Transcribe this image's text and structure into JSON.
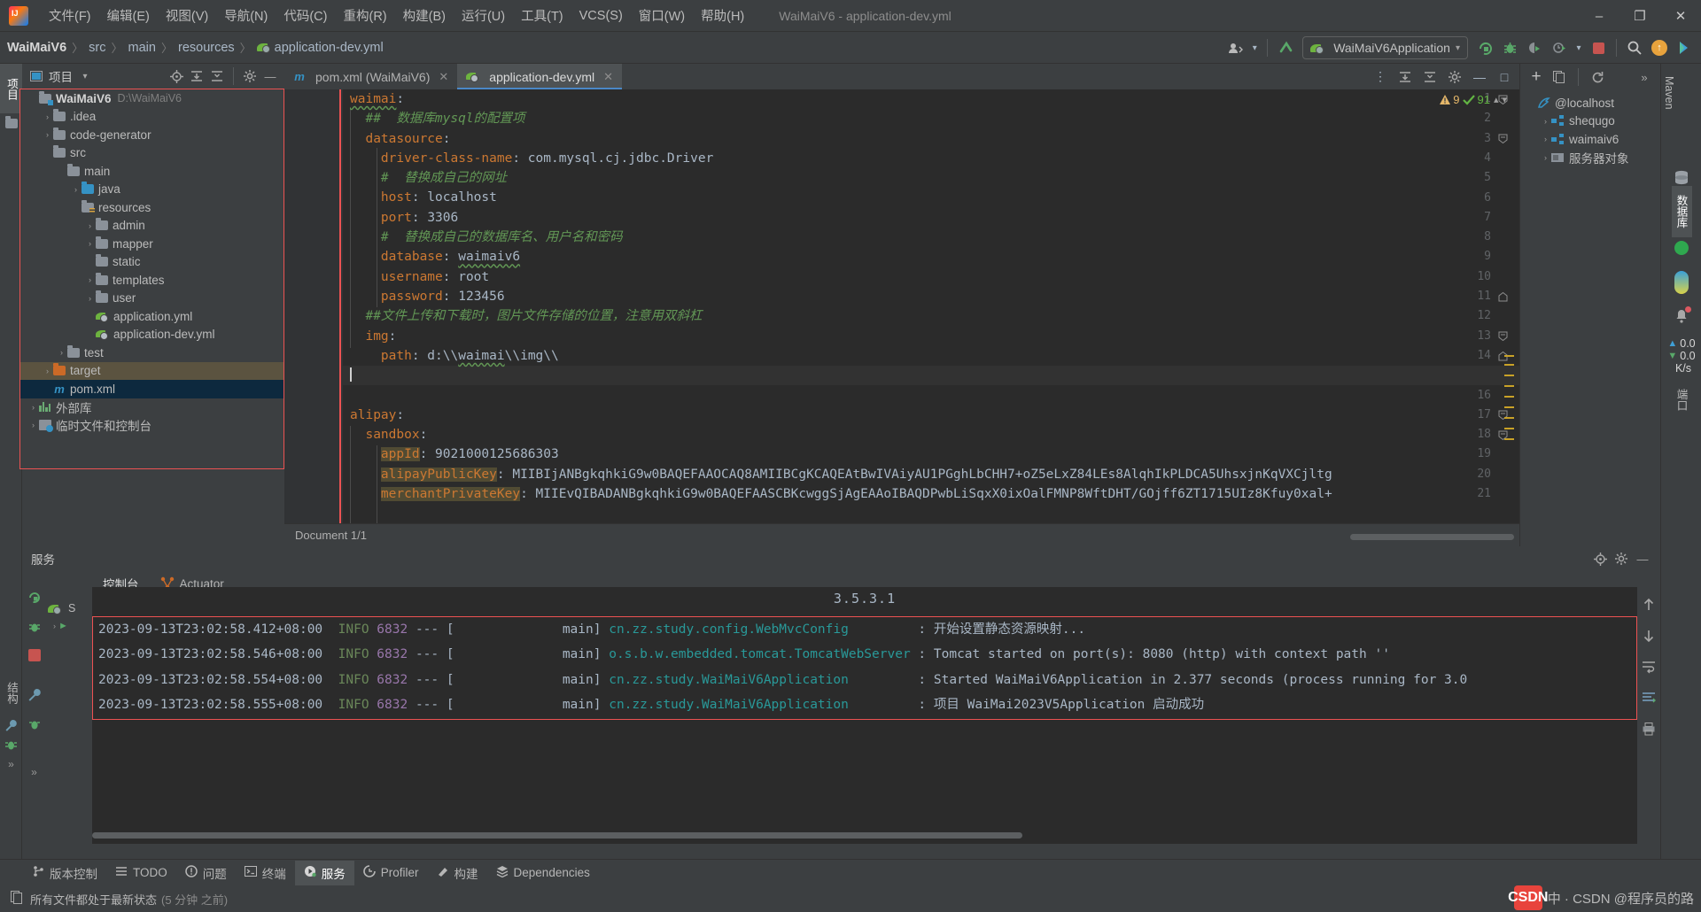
{
  "window": {
    "title": "WaiMaiV6 - application-dev.yml",
    "controls": {
      "minimize": "–",
      "maximize": "❐",
      "close": "✕"
    }
  },
  "menubar": {
    "logo": "intellij-idea-logo",
    "items": [
      {
        "label": "文件(F)",
        "name": "menu-file"
      },
      {
        "label": "编辑(E)",
        "name": "menu-edit"
      },
      {
        "label": "视图(V)",
        "name": "menu-view"
      },
      {
        "label": "导航(N)",
        "name": "menu-navigate"
      },
      {
        "label": "代码(C)",
        "name": "menu-code"
      },
      {
        "label": "重构(R)",
        "name": "menu-refactor"
      },
      {
        "label": "构建(B)",
        "name": "menu-build"
      },
      {
        "label": "运行(U)",
        "name": "menu-run"
      },
      {
        "label": "工具(T)",
        "name": "menu-tools"
      },
      {
        "label": "VCS(S)",
        "name": "menu-vcs"
      },
      {
        "label": "窗口(W)",
        "name": "menu-window"
      },
      {
        "label": "帮助(H)",
        "name": "menu-help"
      }
    ]
  },
  "navbar": {
    "crumbs": [
      "WaiMaiV6",
      "src",
      "main",
      "resources",
      "application-dev.yml"
    ],
    "separator": "〉",
    "run_configuration": "WaiMaiV6Application",
    "dropdown_caret": "▾",
    "icons": {
      "share": "share-icon",
      "updating": "update-project-icon",
      "run": "run-icon",
      "debug": "debug-icon",
      "run_coverage": "run-with-coverage-icon",
      "profiler": "profiler-icon",
      "stop": "stop-icon",
      "search": "search-everywhere-icon",
      "updates": "updates-available-icon",
      "ai": "ai-assistant-icon"
    }
  },
  "project_panel": {
    "title": "项目",
    "vertical_tab": "项目",
    "toolbar_icons": [
      "locate-icon",
      "expand-all-icon",
      "collapse-all-icon",
      "settings-icon",
      "hide-icon"
    ],
    "tree": [
      {
        "label": "WaiMaiV6",
        "detail": "D:\\WaiMaiV6",
        "indent": 0,
        "arrow": "ⱟ",
        "icon": "module-folder",
        "bold": true,
        "state": ""
      },
      {
        "label": ".idea",
        "detail": "",
        "indent": 1,
        "arrow": "›",
        "icon": "folder",
        "bold": false,
        "state": ""
      },
      {
        "label": "code-generator",
        "detail": "",
        "indent": 1,
        "arrow": "›",
        "icon": "folder",
        "bold": false,
        "state": ""
      },
      {
        "label": "src",
        "detail": "",
        "indent": 1,
        "arrow": "ⱟ",
        "icon": "folder",
        "bold": false,
        "state": ""
      },
      {
        "label": "main",
        "detail": "",
        "indent": 2,
        "arrow": "ⱟ",
        "icon": "folder",
        "bold": false,
        "state": ""
      },
      {
        "label": "java",
        "detail": "",
        "indent": 3,
        "arrow": "›",
        "icon": "folder-blue",
        "bold": false,
        "state": ""
      },
      {
        "label": "resources",
        "detail": "",
        "indent": 3,
        "arrow": "ⱟ",
        "icon": "folder-resources",
        "bold": false,
        "state": ""
      },
      {
        "label": "admin",
        "detail": "",
        "indent": 4,
        "arrow": "›",
        "icon": "folder",
        "bold": false,
        "state": ""
      },
      {
        "label": "mapper",
        "detail": "",
        "indent": 4,
        "arrow": "›",
        "icon": "folder",
        "bold": false,
        "state": ""
      },
      {
        "label": "static",
        "detail": "",
        "indent": 4,
        "arrow": "",
        "icon": "folder",
        "bold": false,
        "state": ""
      },
      {
        "label": "templates",
        "detail": "",
        "indent": 4,
        "arrow": "›",
        "icon": "folder",
        "bold": false,
        "state": ""
      },
      {
        "label": "user",
        "detail": "",
        "indent": 4,
        "arrow": "›",
        "icon": "folder",
        "bold": false,
        "state": ""
      },
      {
        "label": "application.yml",
        "detail": "",
        "indent": 4,
        "arrow": "",
        "icon": "spring-yaml",
        "bold": false,
        "state": ""
      },
      {
        "label": "application-dev.yml",
        "detail": "",
        "indent": 4,
        "arrow": "",
        "icon": "spring-yaml",
        "bold": false,
        "state": ""
      },
      {
        "label": "test",
        "detail": "",
        "indent": 2,
        "arrow": "›",
        "icon": "folder",
        "bold": false,
        "state": ""
      },
      {
        "label": "target",
        "detail": "",
        "indent": 1,
        "arrow": "›",
        "icon": "folder-orange",
        "bold": false,
        "state": "tan"
      },
      {
        "label": "pom.xml",
        "detail": "",
        "indent": 1,
        "arrow": "",
        "icon": "maven",
        "bold": false,
        "state": "blue"
      },
      {
        "label": "外部库",
        "detail": "",
        "indent": 0,
        "arrow": "›",
        "icon": "library",
        "bold": false,
        "state": ""
      },
      {
        "label": "临时文件和控制台",
        "detail": "",
        "indent": 0,
        "arrow": "›",
        "icon": "scratch",
        "bold": false,
        "state": ""
      }
    ]
  },
  "editor": {
    "tabs": [
      {
        "label": "pom.xml (WaiMaiV6)",
        "icon": "maven-icon",
        "active": false
      },
      {
        "label": "application-dev.yml",
        "icon": "spring-yaml-icon",
        "active": true
      }
    ],
    "inspection": {
      "warnings": "9",
      "weak_warnings": "91",
      "warning_icon": "⚠",
      "check_icon": "✔"
    },
    "status": "Document 1/1",
    "lines": [
      {
        "n": 1,
        "fold": "minus",
        "html": "<span class=\"k wavy\">waimai</span><span class=\"v\">:</span>"
      },
      {
        "n": 2,
        "fold": "",
        "html": "  <span class=\"cm\">##  数据库mysql的配置项</span>"
      },
      {
        "n": 3,
        "fold": "minus",
        "html": "  <span class=\"k\">datasource</span><span class=\"v\">:</span>"
      },
      {
        "n": 4,
        "fold": "",
        "html": "    <span class=\"k\">driver-class-name</span><span class=\"v\">: com.mysql.cj.jdbc.Driver</span>"
      },
      {
        "n": 5,
        "fold": "",
        "html": "    <span class=\"cm\">#  替换成自己的网址</span>"
      },
      {
        "n": 6,
        "fold": "",
        "html": "    <span class=\"k\">host</span><span class=\"v\">: localhost</span>"
      },
      {
        "n": 7,
        "fold": "",
        "html": "    <span class=\"k\">port</span><span class=\"v\">: </span><span class=\"num\">3306</span>"
      },
      {
        "n": 8,
        "fold": "",
        "html": "    <span class=\"cm\">#  替换成自己的数据库名、用户名和密码</span>"
      },
      {
        "n": 9,
        "fold": "",
        "html": "    <span class=\"k\">database</span><span class=\"v\">: </span><span class=\"v wavy\">waimaiv6</span>"
      },
      {
        "n": 10,
        "fold": "",
        "html": "    <span class=\"k\">username</span><span class=\"v\">: root</span>"
      },
      {
        "n": 11,
        "fold": "end",
        "html": "    <span class=\"k\">password</span><span class=\"v\">: </span><span class=\"num\">123456</span>"
      },
      {
        "n": 12,
        "fold": "",
        "html": "  <span class=\"cm\">##文件上传和下载时，图片文件存储的位置，注意用双斜杠</span>"
      },
      {
        "n": 13,
        "fold": "minus",
        "html": "  <span class=\"k\">img</span><span class=\"v\">:</span>"
      },
      {
        "n": 14,
        "fold": "end",
        "html": "    <span class=\"k\">path</span><span class=\"v\">: d:\\\\</span><span class=\"v wavy\">waimai</span><span class=\"v\">\\\\img\\\\</span>"
      },
      {
        "n": 15,
        "fold": "",
        "html": "<span class=\"caret\"></span>",
        "current": true
      },
      {
        "n": 16,
        "fold": "",
        "html": ""
      },
      {
        "n": 17,
        "fold": "minus",
        "html": "<span class=\"k\">alipay</span><span class=\"v\">:</span>"
      },
      {
        "n": 18,
        "fold": "minus",
        "html": "  <span class=\"k\">sandbox</span><span class=\"v\">:</span>"
      },
      {
        "n": 19,
        "fold": "",
        "html": "    <span class=\"k hl\">appId</span><span class=\"v\">: </span><span class=\"num\">9021000125686303</span>"
      },
      {
        "n": 20,
        "fold": "",
        "html": "    <span class=\"k hl\">alipayPublicKey</span><span class=\"v\">: MIIBIjANBgkqhkiG9w0BAQEFAAOCAQ8AMIIBCgKCAQEAtBwIVAiyAU1PGghLbCHH7+oZ5eLxZ84LEs8AlqhIkPLDCA5UhsxjnKqVXCjltg</span>"
      },
      {
        "n": 21,
        "fold": "",
        "html": "    <span class=\"k hl\">merchantPrivateKey</span><span class=\"v\">: MIIEvQIBADANBgkqhkiG9w0BAQEFAASCBKcwggSjAgEAAoIBAQDPwbLiSqxX0ixOalFMNP8WftDHT/GOjff6ZT1715UIz8Kfuy0xal+</span>"
      }
    ]
  },
  "database_panel": {
    "toolbar": {
      "add": "+",
      "copy": "copy-icon",
      "refresh": "refresh-icon",
      "more": "»"
    },
    "vertical_tabs": [
      "Maven",
      "数据库",
      "端口"
    ],
    "tree": [
      {
        "label": "@localhost",
        "arrow": "ⱟ",
        "icon": "datasource-icon",
        "indent": 0
      },
      {
        "label": "shequgo",
        "arrow": "›",
        "icon": "schema-icon",
        "indent": 1
      },
      {
        "label": "waimaiv6",
        "arrow": "›",
        "icon": "schema-icon",
        "indent": 1
      },
      {
        "label": "服务器对象",
        "arrow": "›",
        "icon": "server-objects-icon",
        "indent": 1
      }
    ],
    "network": {
      "upload": "0.0",
      "download": "0.0",
      "unit": "K/s"
    }
  },
  "services": {
    "header": "服务",
    "vertical_tab": "服务",
    "tabs": [
      {
        "label": "控制台",
        "icon": "",
        "active": true
      },
      {
        "label": "Actuator",
        "icon": "actuator-icon",
        "active": false
      }
    ],
    "toolbar_icons": [
      "rerun-icon",
      "debug-icon",
      "stop-icon",
      "wrench-icon",
      "filter-icon"
    ],
    "right_icons": [
      "scroll-up-icon",
      "scroll-down-icon",
      "soft-wrap-icon",
      "scroll-to-end-icon",
      "print-icon"
    ],
    "version": "3.5.3.1",
    "log": [
      {
        "time": "2023-09-13T23:02:58.412+08:00",
        "level": "INFO",
        "pid": "6832",
        "sep": "--- [",
        "thread": "main]",
        "logger": "cn.zz.study.config.WebMvcConfig",
        "message": ": 开始设置静态资源映射..."
      },
      {
        "time": "2023-09-13T23:02:58.546+08:00",
        "level": "INFO",
        "pid": "6832",
        "sep": "--- [",
        "thread": "main]",
        "logger": "o.s.b.w.embedded.tomcat.TomcatWebServer",
        "message": ": Tomcat started on port(s): 8080 (http) with context path ''"
      },
      {
        "time": "2023-09-13T23:02:58.554+08:00",
        "level": "INFO",
        "pid": "6832",
        "sep": "--- [",
        "thread": "main]",
        "logger": "cn.zz.study.WaiMaiV6Application",
        "message": ": Started WaiMaiV6Application in 2.377 seconds (process running for 3.0"
      },
      {
        "time": "2023-09-13T23:02:58.555+08:00",
        "level": "INFO",
        "pid": "6832",
        "sep": "--- [",
        "thread": "main]",
        "logger": "cn.zz.study.WaiMaiV6Application",
        "message": ": 项目 WaiMai2023V5Application 启动成功"
      }
    ]
  },
  "bottom_bar": {
    "items": [
      {
        "label": "版本控制",
        "icon": "vcs-icon",
        "active": false
      },
      {
        "label": "TODO",
        "icon": "todo-icon",
        "active": false
      },
      {
        "label": "问题",
        "icon": "problems-icon",
        "active": false
      },
      {
        "label": "终端",
        "icon": "terminal-icon",
        "active": false
      },
      {
        "label": "服务",
        "icon": "services-icon",
        "active": true
      },
      {
        "label": "Profiler",
        "icon": "profiler-icon",
        "active": false
      },
      {
        "label": "构建",
        "icon": "build-icon",
        "active": false
      },
      {
        "label": "Dependencies",
        "icon": "dependencies-icon",
        "active": false
      }
    ]
  },
  "status_bar": {
    "icon": "file-status-icon",
    "text": "所有文件都处于最新状态",
    "detail": "(5 分钟 之前)"
  },
  "watermark": {
    "logo": "CSDN",
    "text": "中 · CSDN @程序员的路"
  },
  "colors": {
    "accent_blue": "#4a88c7",
    "green": "#59a869",
    "orange_key": "#cc7832",
    "comment_green": "#629755",
    "red_border": "#ec5252",
    "editor_bg": "#2b2b2b",
    "panel_bg": "#3c3f41"
  }
}
